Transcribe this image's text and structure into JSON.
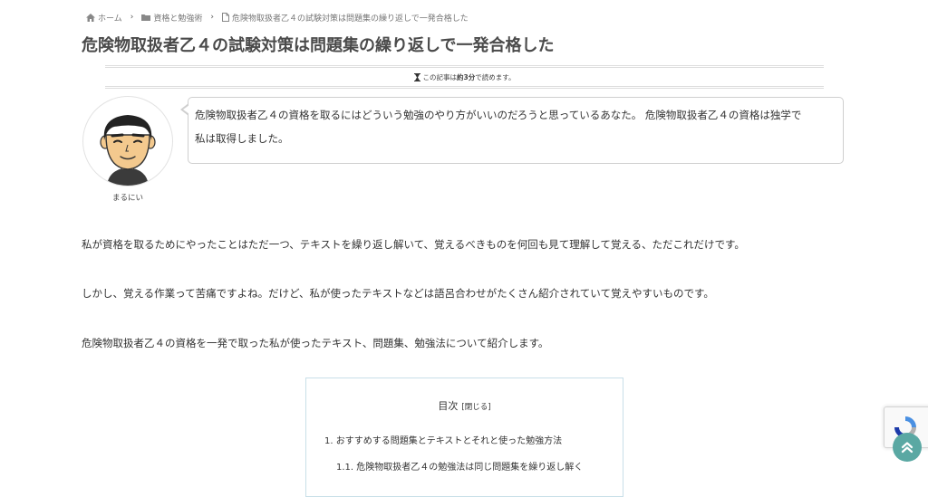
{
  "breadcrumb": {
    "home": "ホーム",
    "category": "資格と勉強術",
    "current": "危険物取扱者乙４の試験対策は問題集の繰り返しで一発合格した"
  },
  "article": {
    "title": "危険物取扱者乙４の試験対策は問題集の繰り返しで一発合格した",
    "read_time": {
      "prefix": "この記事は",
      "value": "約3分",
      "suffix": "で読めます。"
    }
  },
  "speech": {
    "speaker": "まるにい",
    "line1": "危険物取扱者乙４の資格を取るにはどういう勉強のやり方がいいのだろうと思っているあなた。 危険物取扱者乙４の資格は独学で",
    "line2": "私は取得しました。"
  },
  "paragraphs": [
    "私が資格を取るためにやったことはただ一つ、テキストを繰り返し解いて、覚えるべきものを何回も見て理解して覚える、ただこれだけです。",
    "しかし、覚える作業って苦痛ですよね。だけど、私が使ったテキストなどは語呂合わせがたくさん紹介されていて覚えやすいものです。",
    "危険物取扱者乙４の資格を一発で取った私が使ったテキスト、問題集、勉強法について紹介します。"
  ],
  "toc": {
    "title": "目次",
    "toggle": "[閉じる]",
    "items": [
      "1. おすすめする問題集とテキストとそれと使った勉強方法",
      "1.1. 危険物取扱者乙４の勉強法は同じ問題集を繰り返し解く"
    ]
  },
  "icons": {
    "home": "home-icon",
    "folder": "folder-icon",
    "file": "file-icon",
    "chevron": "chevron-right-icon",
    "hourglass": "hourglass-icon",
    "to_top": "double-chevron-up-icon",
    "recaptcha": "recaptcha-icon"
  },
  "colors": {
    "accent": "#5aa8a3",
    "toc_border": "#c8dfe8",
    "title": "#4a4a4a"
  }
}
